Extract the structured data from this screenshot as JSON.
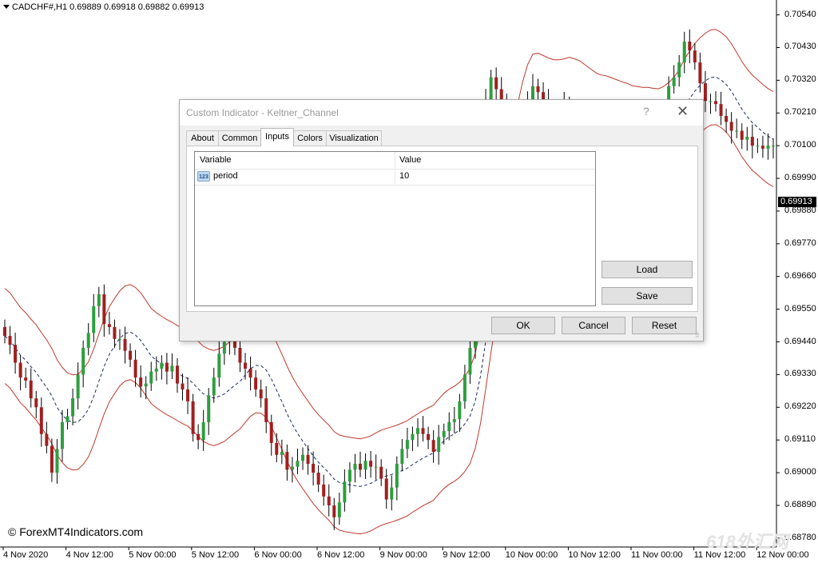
{
  "chart_header": {
    "symbol_info": "CADCHF#,H1  0.69889 0.69918 0.69882 0.69913"
  },
  "copyright": "© ForexMT4Indicators.com",
  "watermark": "618外汇网",
  "current_price": "0.69913",
  "price_axis": [
    "0.70540",
    "0.70430",
    "0.70320",
    "0.70210",
    "0.70100",
    "0.69990",
    "0.69880",
    "0.69770",
    "0.69660",
    "0.69550",
    "0.69440",
    "0.69330",
    "0.69220",
    "0.69110",
    "0.69000",
    "0.68890",
    "0.68780"
  ],
  "time_axis": [
    "4 Nov 2020",
    "4 Nov 12:00",
    "5 Nov 00:00",
    "5 Nov 12:00",
    "6 Nov 00:00",
    "6 Nov 12:00",
    "9 Nov 00:00",
    "9 Nov 12:00",
    "10 Nov 00:00",
    "10 Nov 12:00",
    "11 Nov 00:00",
    "11 Nov 12:00",
    "12 Nov 00:00"
  ],
  "colors": {
    "bull": "#2e9e3f",
    "bear": "#a11f1f",
    "channel": "#c0392b",
    "midline": "#1b2a6b",
    "background": "#ffffff"
  },
  "chart_data": {
    "type": "candlestick",
    "symbol": "CADCHF#",
    "timeframe": "H1",
    "ylim": [
      0.6875,
      0.7059
    ],
    "closes": [
      0.6946,
      0.6943,
      0.6937,
      0.6932,
      0.6931,
      0.6925,
      0.6922,
      0.6913,
      0.6909,
      0.69,
      0.6908,
      0.6917,
      0.6919,
      0.6925,
      0.6933,
      0.6942,
      0.6947,
      0.6956,
      0.696,
      0.695,
      0.6949,
      0.6945,
      0.6945,
      0.6941,
      0.6938,
      0.6932,
      0.6929,
      0.693,
      0.6934,
      0.6935,
      0.6937,
      0.6934,
      0.6936,
      0.693,
      0.6928,
      0.6924,
      0.6913,
      0.6911,
      0.6917,
      0.6926,
      0.6932,
      0.694,
      0.6944,
      0.6945,
      0.6942,
      0.6937,
      0.6935,
      0.6932,
      0.6928,
      0.6925,
      0.6917,
      0.691,
      0.6906,
      0.6907,
      0.6901,
      0.6902,
      0.6904,
      0.6906,
      0.6903,
      0.69,
      0.6896,
      0.6892,
      0.6889,
      0.6885,
      0.689,
      0.6897,
      0.6901,
      0.6903,
      0.6901,
      0.6904,
      0.6902,
      0.6902,
      0.6898,
      0.6891,
      0.6895,
      0.6903,
      0.6908,
      0.6911,
      0.6913,
      0.6915,
      0.6913,
      0.6911,
      0.6907,
      0.6912,
      0.6914,
      0.6917,
      0.6918,
      0.6924,
      0.6933,
      0.6942,
      0.6964,
      0.6994,
      0.7025,
      0.7033,
      0.7029,
      0.7025,
      0.702,
      0.7021,
      0.7017,
      0.7023,
      0.7025,
      0.703,
      0.7028,
      0.7025,
      0.7021,
      0.7019,
      0.702,
      0.7024,
      0.7022,
      0.7018,
      0.7018,
      0.7017,
      0.7015,
      0.7012,
      0.7013,
      0.7016,
      0.7014,
      0.7017,
      0.7015,
      0.7013,
      0.701,
      0.7014,
      0.7012,
      0.7012,
      0.701,
      0.7014,
      0.7022,
      0.703,
      0.7033,
      0.7038,
      0.7045,
      0.7042,
      0.7038,
      0.7031,
      0.7025,
      0.7025,
      0.7024,
      0.702,
      0.7018,
      0.7015,
      0.7015,
      0.7012,
      0.7013,
      0.701,
      0.701,
      0.7009,
      0.701,
      0.701
    ]
  },
  "dialog": {
    "title": "Custom Indicator - Keltner_Channel",
    "help": "?",
    "close": "✕",
    "tabs": [
      "About",
      "Common",
      "Inputs",
      "Colors",
      "Visualization"
    ],
    "grid_headers": {
      "variable": "Variable",
      "value": "Value"
    },
    "inputs": [
      {
        "icon": "123",
        "name": "period",
        "value": "10"
      }
    ],
    "buttons": {
      "load": "Load",
      "save": "Save",
      "ok": "OK",
      "cancel": "Cancel",
      "reset": "Reset"
    }
  }
}
